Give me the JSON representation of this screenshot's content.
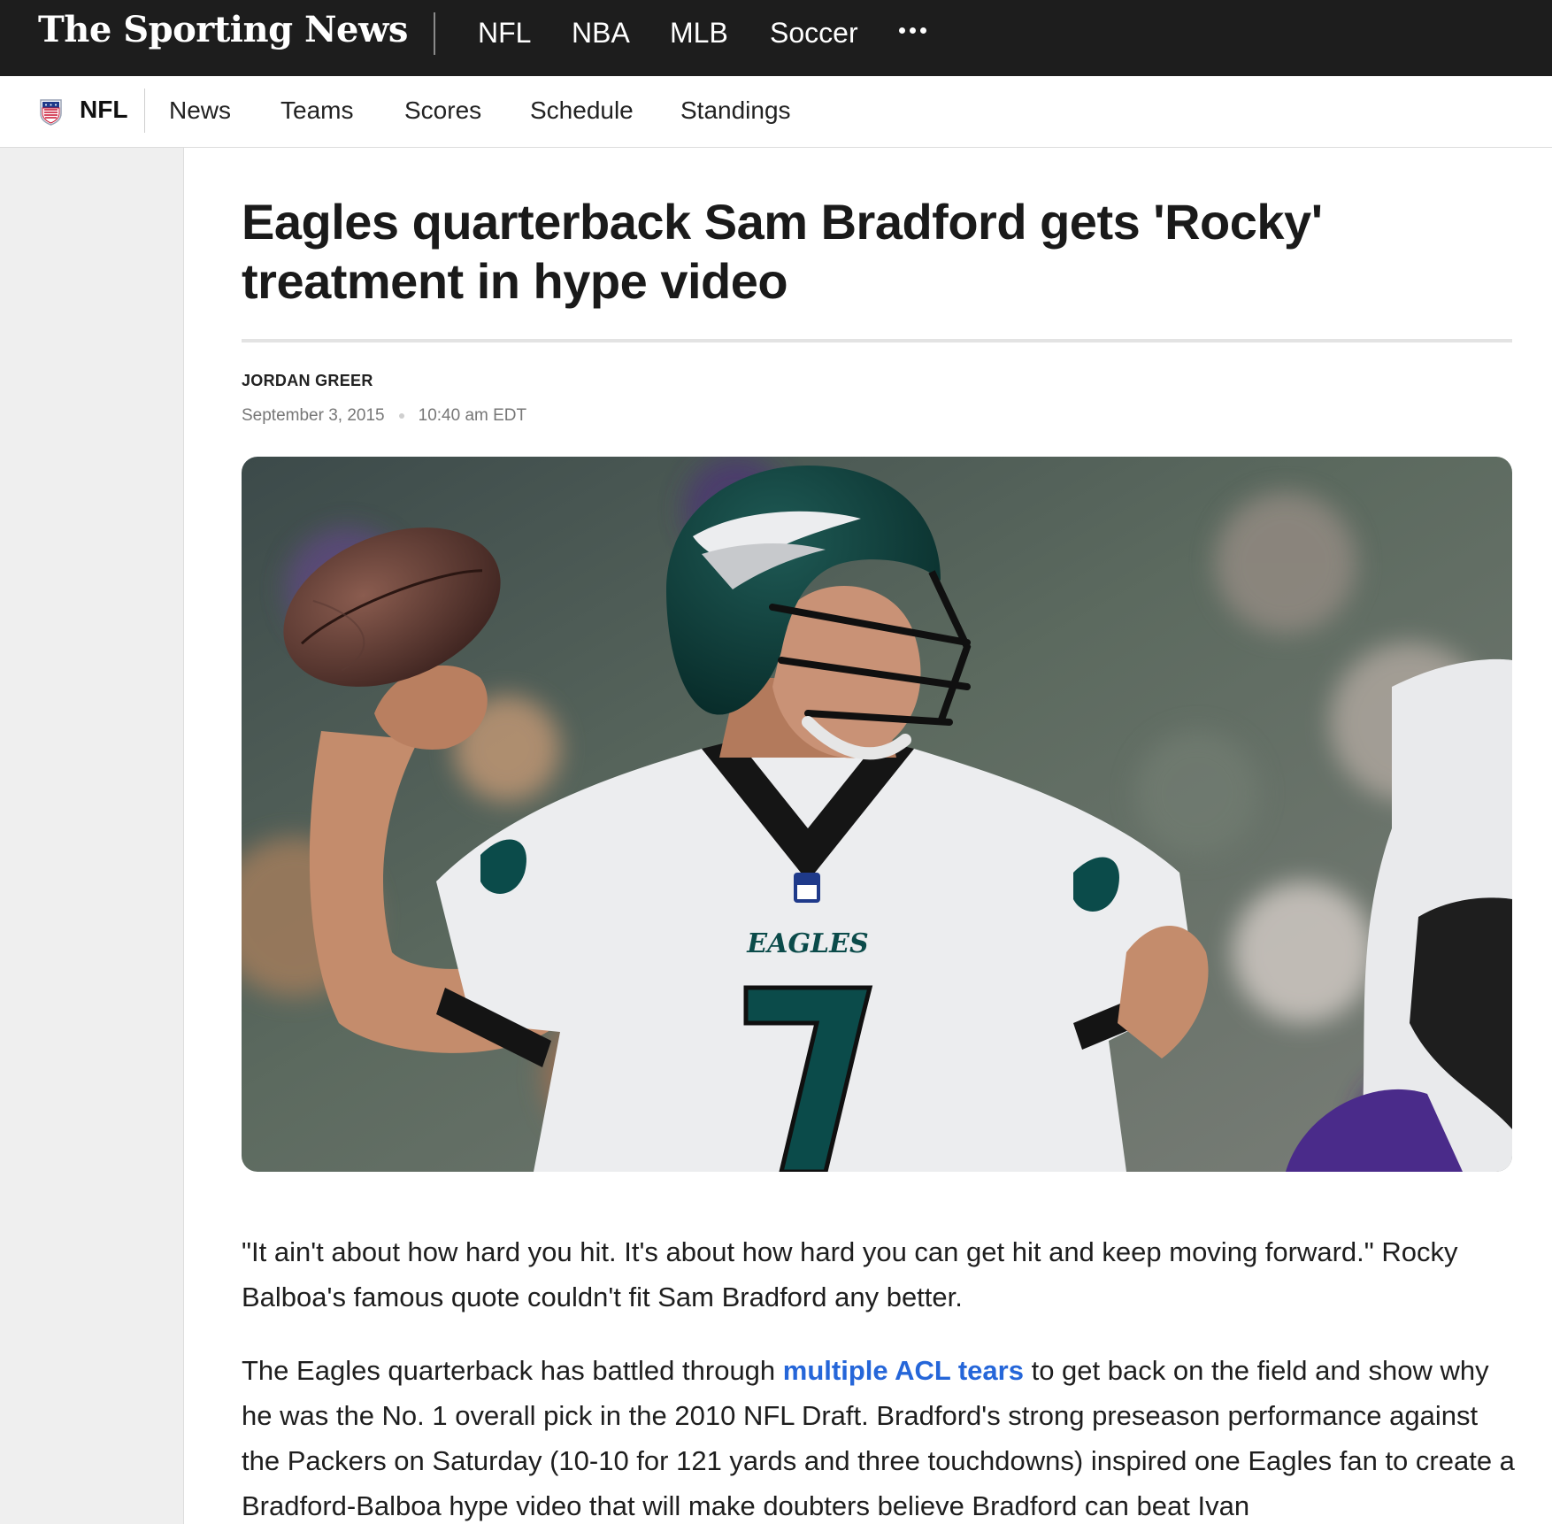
{
  "header": {
    "brand": "The Sporting News",
    "nav": [
      "NFL",
      "NBA",
      "MLB",
      "Soccer"
    ],
    "more_icon": "more-horizontal-icon"
  },
  "subnav": {
    "logo_icon": "nfl-shield-icon",
    "section": "NFL",
    "links": [
      "News",
      "Teams",
      "Scores",
      "Schedule",
      "Standings"
    ]
  },
  "article": {
    "headline": "Eagles quarterback Sam Bradford gets 'Rocky' treatment in hype video",
    "author": "JORDAN GREER",
    "date": "September 3, 2015",
    "time": "10:40 am EDT",
    "image_alt": "Eagles quarterback Sam Bradford (7) throwing a football",
    "paragraph1": "\"It ain't about how hard you hit. It's about how hard you can get hit and keep moving forward.\" Rocky Balboa's famous quote couldn't fit Sam Bradford any better.",
    "paragraph2_before": "The Eagles quarterback has battled through ",
    "paragraph2_link": "multiple ACL tears",
    "paragraph2_after": " to get back on the field and show why he was the No. 1 overall pick in the 2010 NFL Draft. Bradford's strong preseason performance against the Packers on Saturday (10-10 for 121 yards and three touchdowns) inspired one Eagles fan to create a Bradford-Balboa hype video that will make doubters believe Bradford can beat Ivan"
  },
  "colors": {
    "topbar_bg": "#1d1d1d",
    "link": "#2566d9",
    "eagles_green": "#0b4b4a"
  }
}
